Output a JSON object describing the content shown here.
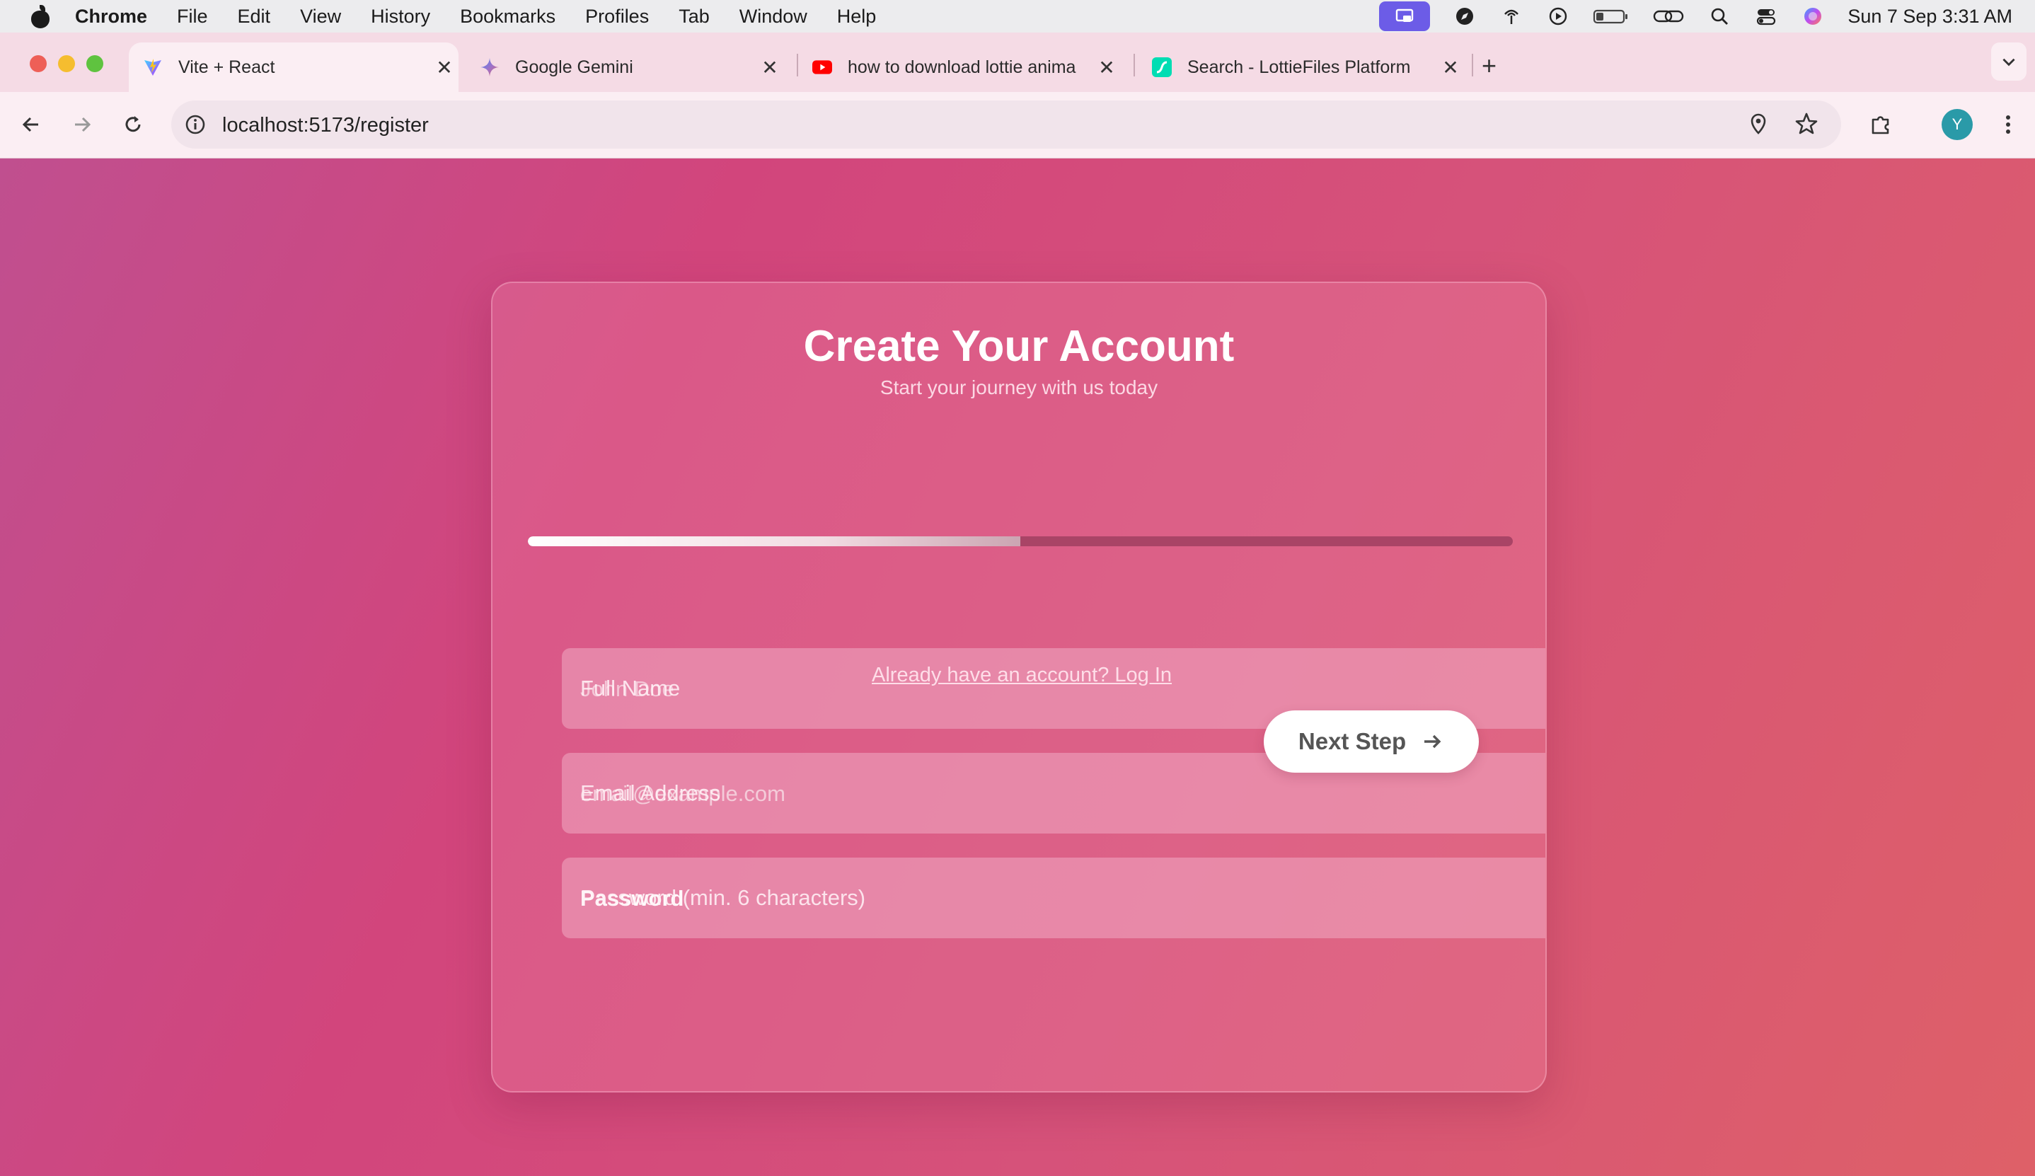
{
  "menubar": {
    "app": "Chrome",
    "items": [
      "File",
      "Edit",
      "View",
      "History",
      "Bookmarks",
      "Profiles",
      "Tab",
      "Window",
      "Help"
    ],
    "clock": "Sun 7 Sep  3:31 AM"
  },
  "tabs": [
    {
      "title": "Vite + React",
      "icon": "vite-icon",
      "active": true
    },
    {
      "title": "Google Gemini",
      "icon": "gemini-icon",
      "active": false
    },
    {
      "title": "how to download lottie anima",
      "icon": "youtube-icon",
      "active": false
    },
    {
      "title": "Search - LottieFiles Platform",
      "icon": "lottiefiles-icon",
      "active": false
    }
  ],
  "toolbar": {
    "url": "localhost:5173/register",
    "avatar_letter": "Y"
  },
  "card": {
    "title": "Create Your Account",
    "subtitle": "Start your journey with us today",
    "progress_fraction": 0.5
  },
  "form": {
    "full_name_placeholder": "Full Name",
    "full_name_ghost": "John Doe",
    "email_placeholder": "Email Address",
    "email_ghost": "email@example.com",
    "password_label": "Password",
    "password_placeholder": "Password (min. 6 characters)",
    "next_label": "Next Step",
    "login_link": "Already have an account? Log In"
  },
  "colors": {
    "accent": "#d6527a",
    "avatar": "#2a9aa8",
    "active_sys_icon": "#6c5ce7"
  }
}
